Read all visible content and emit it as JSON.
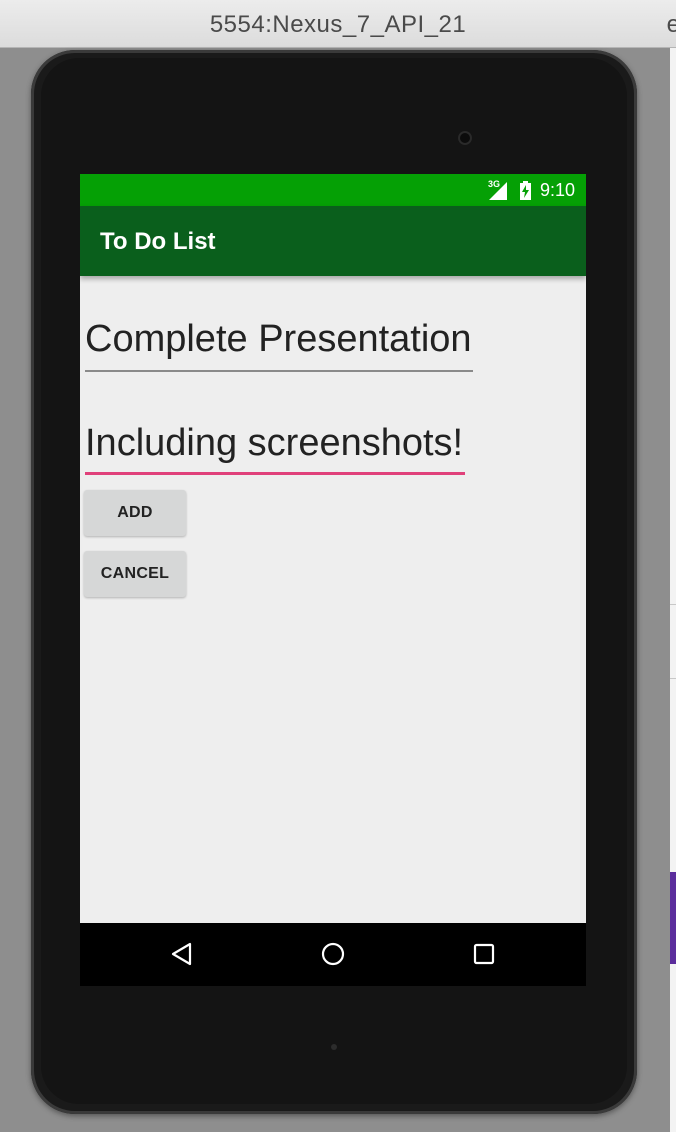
{
  "window": {
    "title": "5554:Nexus_7_API_21",
    "edge_glyph": "e"
  },
  "statusbar": {
    "network": "3G",
    "time": "9:10",
    "signal_icon": "cell-signal-icon",
    "battery_icon": "battery-charging-icon"
  },
  "appbar": {
    "title": "To Do List"
  },
  "form": {
    "title_value": "Complete Presentation",
    "description_value": "Including screenshots!",
    "add_label": "ADD",
    "cancel_label": "CANCEL"
  },
  "navbar": {
    "back_icon": "back-triangle-icon",
    "home_icon": "home-circle-icon",
    "recent_icon": "recent-apps-square-icon"
  },
  "colors": {
    "statusbar": "#05a005",
    "appbar": "#0a5f1c",
    "accent_underline": "#e0407a",
    "screen_background": "#eeeeee"
  }
}
